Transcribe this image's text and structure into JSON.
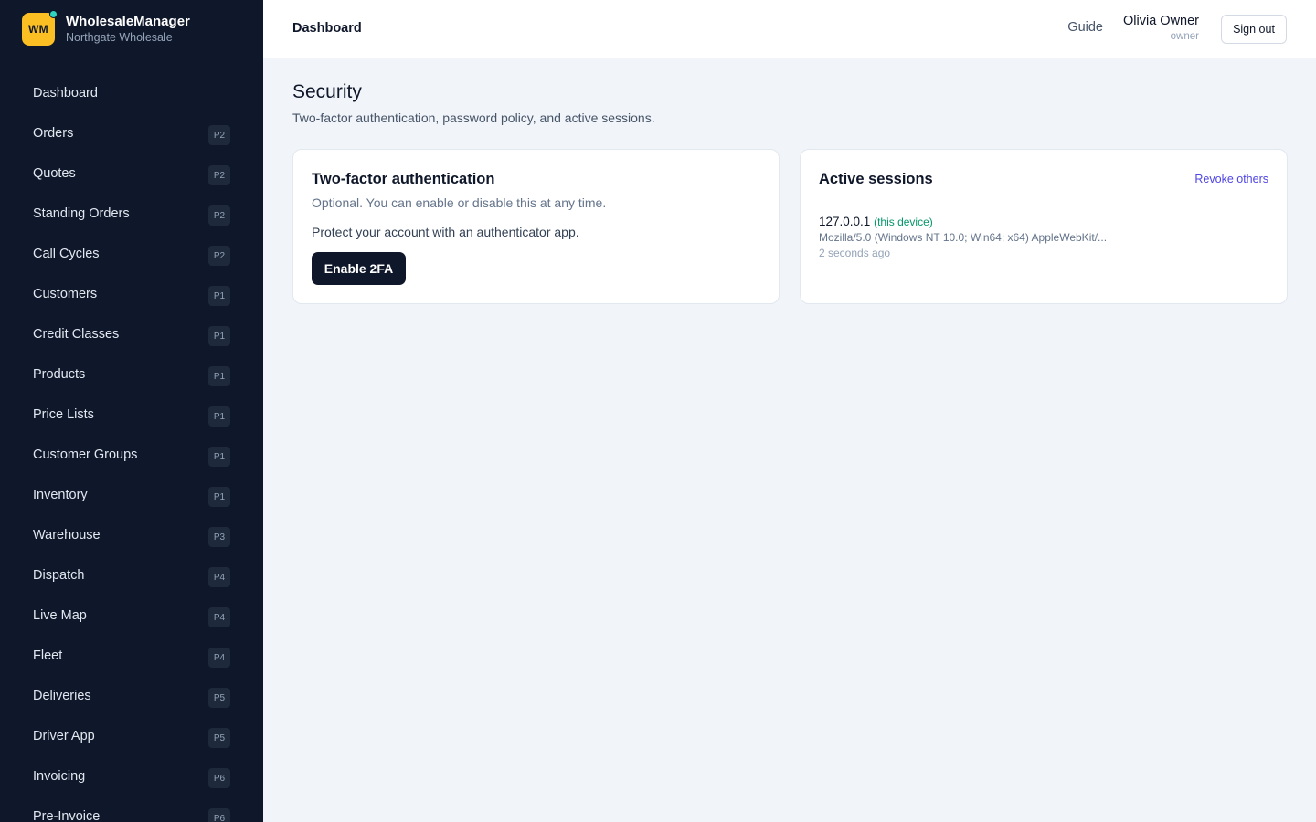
{
  "brand": {
    "logo_text": "WM",
    "name": "WholesaleManager",
    "subtitle": "Northgate Wholesale"
  },
  "sidebar": {
    "items": [
      {
        "label": "Dashboard",
        "badge": ""
      },
      {
        "label": "Orders",
        "badge": "P2"
      },
      {
        "label": "Quotes",
        "badge": "P2"
      },
      {
        "label": "Standing Orders",
        "badge": "P2"
      },
      {
        "label": "Call Cycles",
        "badge": "P2"
      },
      {
        "label": "Customers",
        "badge": "P1"
      },
      {
        "label": "Credit Classes",
        "badge": "P1"
      },
      {
        "label": "Products",
        "badge": "P1"
      },
      {
        "label": "Price Lists",
        "badge": "P1"
      },
      {
        "label": "Customer Groups",
        "badge": "P1"
      },
      {
        "label": "Inventory",
        "badge": "P1"
      },
      {
        "label": "Warehouse",
        "badge": "P3"
      },
      {
        "label": "Dispatch",
        "badge": "P4"
      },
      {
        "label": "Live Map",
        "badge": "P4"
      },
      {
        "label": "Fleet",
        "badge": "P4"
      },
      {
        "label": "Deliveries",
        "badge": "P5"
      },
      {
        "label": "Driver App",
        "badge": "P5"
      },
      {
        "label": "Invoicing",
        "badge": "P6"
      },
      {
        "label": "Pre-Invoice",
        "badge": "P6"
      }
    ]
  },
  "header": {
    "title": "Dashboard",
    "guide_label": "Guide",
    "user_name": "Olivia Owner",
    "user_role": "owner",
    "signout_label": "Sign out"
  },
  "page": {
    "title": "Security",
    "subtitle": "Two-factor authentication, password policy, and active sessions."
  },
  "two_factor": {
    "title": "Two-factor authentication",
    "description": "Optional. You can enable or disable this at any time.",
    "text": "Protect your account with an authenticator app.",
    "button_label": "Enable 2FA"
  },
  "sessions": {
    "title": "Active sessions",
    "revoke_label": "Revoke others",
    "items": [
      {
        "ip": "127.0.0.1",
        "tag": "(this device)",
        "user_agent": "Mozilla/5.0 (Windows NT 10.0; Win64; x64) AppleWebKit/...",
        "time": "2 seconds ago"
      }
    ]
  },
  "colors": {
    "sidebar_bg": "#0f172a",
    "logo_bg": "#fbbf24",
    "accent_link": "#4f46e5",
    "device_tag": "#059669"
  }
}
